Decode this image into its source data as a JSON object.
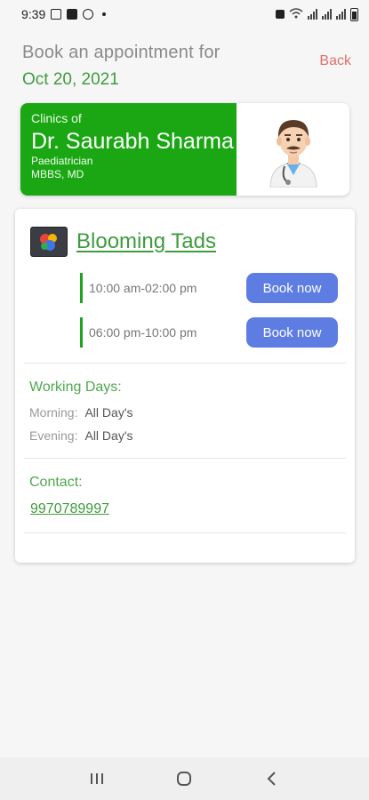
{
  "status_bar": {
    "time": "9:39"
  },
  "header": {
    "title": "Book an appointment for",
    "date": "Oct 20, 2021",
    "back_label": "Back"
  },
  "doctor": {
    "clinics_of": "Clinics of",
    "name": "Dr. Saurabh Sharma",
    "specialty": "Paediatrician",
    "degree": "MBBS, MD",
    "avatar_icon": "doctor-avatar-icon"
  },
  "clinic": {
    "name": "Blooming Tads",
    "slots": [
      {
        "time": "10:00 am-02:00 pm",
        "button": "Book now"
      },
      {
        "time": "06:00 pm-10:00 pm",
        "button": "Book now"
      }
    ],
    "working_days": {
      "title": "Working Days:",
      "morning_label": "Morning:",
      "morning_value": "All Day's",
      "evening_label": "Evening:",
      "evening_value": "All Day's"
    },
    "contact": {
      "title": "Contact:",
      "phone": "9970789997"
    }
  },
  "colors": {
    "accent_green": "#1aa713",
    "text_green": "#3e9b3e",
    "button_blue": "#5d7de3",
    "back_red": "#e0706b"
  }
}
